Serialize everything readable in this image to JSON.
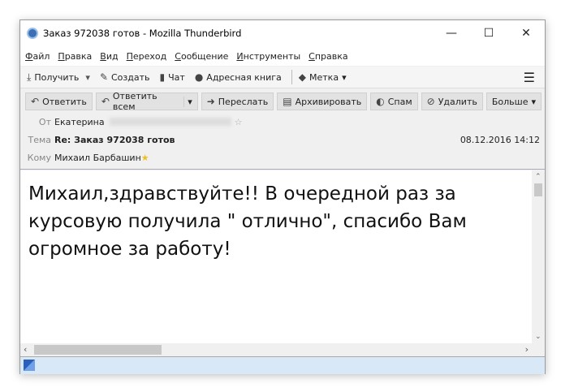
{
  "window": {
    "title": "Заказ 972038 готов - Mozilla Thunderbird"
  },
  "menu": [
    "Файл",
    "Правка",
    "Вид",
    "Переход",
    "Сообщение",
    "Инструменты",
    "Справка"
  ],
  "toolbar": {
    "get": "Получить",
    "create": "Создать",
    "chat": "Чат",
    "addressbook": "Адресная книга",
    "tag": "Метка"
  },
  "message_toolbar": {
    "reply": "Ответить",
    "reply_all": "Ответить всем",
    "forward": "Переслать",
    "archive": "Архивировать",
    "spam": "Спам",
    "delete": "Удалить",
    "more": "Больше"
  },
  "header": {
    "from_label": "От",
    "from": "Екатерина",
    "subject_label": "Тема",
    "subject": "Re: Заказ 972038 готов",
    "date": "08.12.2016 14:12",
    "to_label": "Кому",
    "to": "Михаил Барбашин"
  },
  "body": {
    "text": "Михаил,здравствуйте!! В очередной раз за курсовую получила \" отлично\", спасибо Вам огромное за работу!"
  }
}
